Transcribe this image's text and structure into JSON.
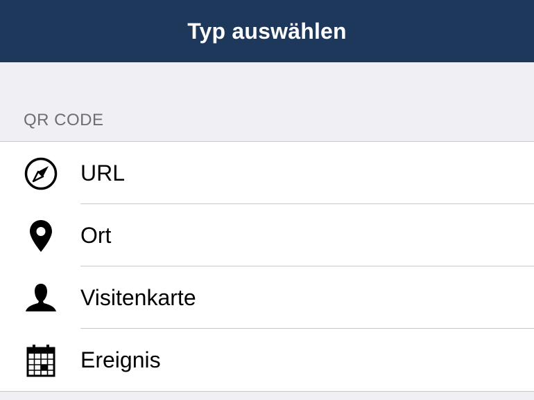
{
  "navbar": {
    "title": "Typ auswählen",
    "background_color": "#1e385c"
  },
  "section": {
    "header": "QR CODE"
  },
  "items": [
    {
      "label": "URL",
      "icon": "compass-icon"
    },
    {
      "label": "Ort",
      "icon": "location-pin-icon"
    },
    {
      "label": "Visitenkarte",
      "icon": "person-icon"
    },
    {
      "label": "Ereignis",
      "icon": "calendar-icon"
    }
  ]
}
